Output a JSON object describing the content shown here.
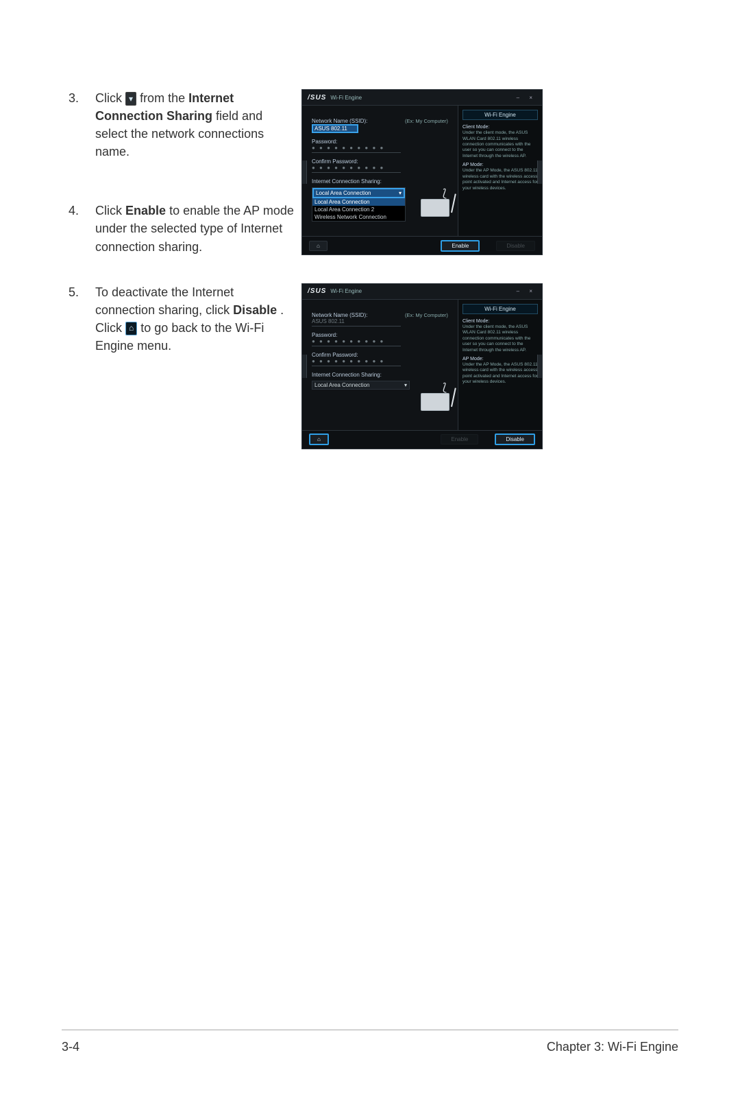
{
  "steps": {
    "s3": {
      "num": "3.",
      "pre": "Click ",
      "mid": " from the ",
      "bold1": "Internet Connection Sharing",
      "post": " field and select the network connections name."
    },
    "s4": {
      "num": "4.",
      "pre": "Click ",
      "bold1": "Enable",
      "post": " to enable the AP mode under the selected type of Internet connection sharing."
    },
    "s5": {
      "num": "5.",
      "pre": "To deactivate the Internet connection sharing, click ",
      "bold1": "Disable",
      "mid": ". Click ",
      "post": "to go back to the Wi-Fi Engine menu."
    }
  },
  "app": {
    "brand": "/SUS",
    "title": "Wi-Fi Engine",
    "minclose": "–   ×",
    "sidepanel": "Wi-Fi Engine",
    "labels": {
      "netname": "Network Name (SSID):",
      "password": "Password:",
      "confirm": "Confirm Password:",
      "ics": "Internet Connection Sharing:"
    },
    "values": {
      "ssid": "ASUS 802.11",
      "annot": "(Ex: My Computer)",
      "dots": "● ● ● ● ● ● ● ● ● ●"
    },
    "dropdown": {
      "selected": "Local Area Connection",
      "opts": [
        "Local Area Connection",
        "Local Area Connection 2",
        "Wireless Network Connection"
      ]
    },
    "side": {
      "clientT": "Client Mode:",
      "client": "Under the client mode, the ASUS WLAN Card 802.11 wireless connection communicates with the user so you can connect to the Internet through the wireless AP.",
      "apT": "AP Mode:",
      "ap": "Under the AP Mode, the ASUS 802.11 wireless card with the wireless access point activated and Internet access for your wireless devices."
    },
    "buttons": {
      "home": "⌂",
      "enable": "Enable",
      "disable": "Disable"
    }
  },
  "footer": {
    "left": "3-4",
    "right": "Chapter 3: Wi-Fi Engine"
  }
}
